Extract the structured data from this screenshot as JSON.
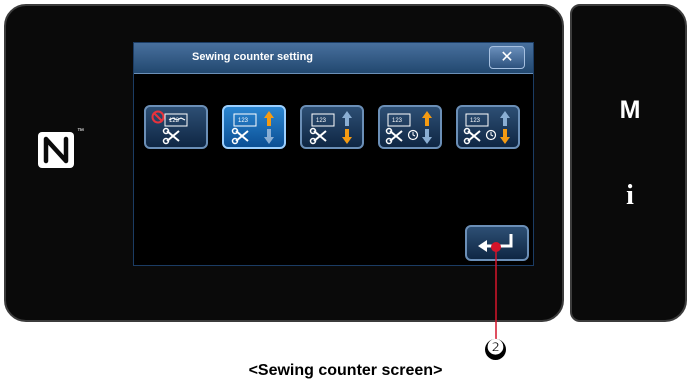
{
  "dialog": {
    "title": "Sewing counter setting",
    "close_symbol": "✕"
  },
  "panel_keys": {
    "m": "M",
    "info": "i"
  },
  "counter_modes": [
    {
      "icon": "counter-disabled-icon",
      "selected": false
    },
    {
      "icon": "counter-up-icon",
      "selected": true
    },
    {
      "icon": "counter-down-icon",
      "selected": false
    },
    {
      "icon": "counter-timed-up-icon",
      "selected": false
    },
    {
      "icon": "counter-timed-down-icon",
      "selected": false
    }
  ],
  "enter_button": {
    "icon": "enter-return-icon"
  },
  "callout_number": "❷",
  "caption": "<Sewing counter screen>",
  "colors": {
    "arrow_active": "#f59b12",
    "arrow_inactive": "#8aaed3",
    "selected_button": "#1e6fbd",
    "disabled_mark": "#e8323c",
    "callout_line": "#d4142a"
  }
}
